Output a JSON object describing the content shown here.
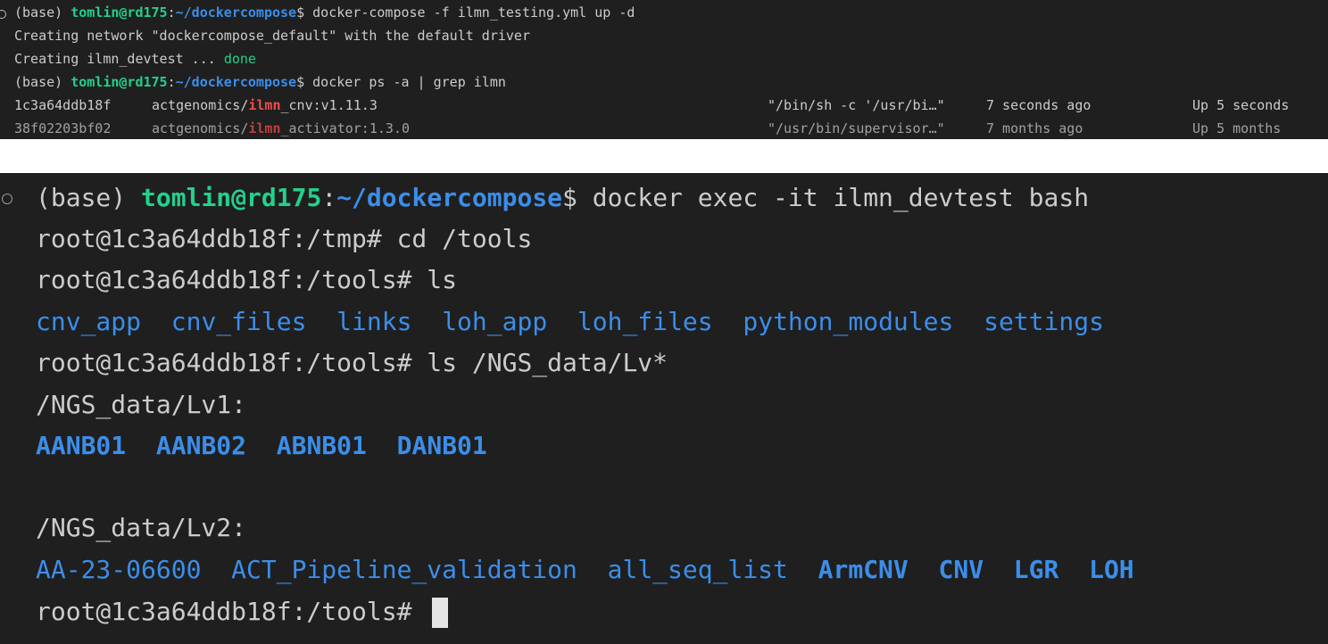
{
  "top_terminal": {
    "line1": {
      "prefix": "(base) ",
      "user_host": "tomlin@rd175",
      "colon": ":",
      "path": "~/dockercompose",
      "dollar": "$",
      "command": " docker-compose -f ilmn_testing.yml up -d"
    },
    "line2": "Creating network \"dockercompose_default\" with the default driver",
    "line3": {
      "text": "Creating ilmn_devtest ... ",
      "status": "done"
    },
    "line4": {
      "prefix": "(base) ",
      "user_host": "tomlin@rd175",
      "colon": ":",
      "path": "~/dockercompose",
      "dollar": "$",
      "command": " docker ps -a | grep ilmn"
    },
    "ps_rows": [
      {
        "id": "1c3a64ddb18f",
        "image_prefix": "actgenomics/",
        "image_highlight": "ilmn",
        "image_suffix": "_cnv:v1.11.3",
        "command": "\"/bin/sh -c '/usr/bi…\"",
        "created": "7 seconds ago",
        "status": "Up 5 seconds"
      },
      {
        "id": "38f02203bf02",
        "image_prefix": "actgenomics/",
        "image_highlight": "ilmn",
        "image_suffix": "_activator:1.3.0",
        "command": "\"/usr/bin/supervisor…\"",
        "created": "7 months ago",
        "status": "Up 5 months"
      }
    ]
  },
  "bottom_terminal": {
    "line1": {
      "prefix": "(base) ",
      "user_host": "tomlin@rd175",
      "colon": ":",
      "path": "~/dockercompose",
      "dollar": "$",
      "command": " docker exec -it ilmn_devtest bash"
    },
    "line2": "root@1c3a64ddb18f:/tmp# cd /tools",
    "line3": "root@1c3a64ddb18f:/tools# ls",
    "ls_tools": [
      "cnv_app",
      "cnv_files",
      "links",
      "loh_app",
      "loh_files",
      "python_modules",
      "settings"
    ],
    "line5": "root@1c3a64ddb18f:/tools# ls /NGS_data/Lv*",
    "lv1_header": "/NGS_data/Lv1:",
    "lv1_items": [
      "AANB01",
      "AANB02",
      "ABNB01",
      "DANB01"
    ],
    "lv2_header": "/NGS_data/Lv2:",
    "lv2_items": [
      "AA-23-06600",
      "ACT_Pipeline_validation",
      "all_seq_list",
      "ArmCNV",
      "CNV",
      "LGR",
      "LOH"
    ],
    "prompt": "root@1c3a64ddb18f:/tools# "
  }
}
